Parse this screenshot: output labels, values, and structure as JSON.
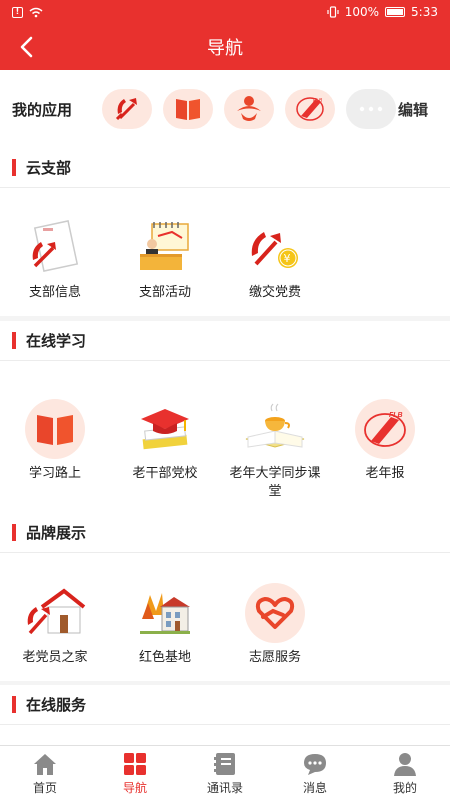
{
  "status_bar": {
    "battery": "100%",
    "time": "5:33"
  },
  "header": {
    "title": "导航"
  },
  "my_apps": {
    "label": "我的应用",
    "edit_label": "编辑",
    "icons": [
      "party-emblem-icon",
      "book-icon",
      "person-emblem-icon",
      "newspaper-logo-icon",
      "more-dots-icon"
    ]
  },
  "sections": [
    {
      "title": "云支部",
      "items": [
        {
          "label": "支部信息",
          "icon": "party-document-icon"
        },
        {
          "label": "支部活动",
          "icon": "meeting-podium-icon"
        },
        {
          "label": "缴交党费",
          "icon": "party-fee-icon"
        }
      ]
    },
    {
      "title": "在线学习",
      "items": [
        {
          "label": "学习路上",
          "icon": "book-icon"
        },
        {
          "label": "老干部党校",
          "icon": "graduation-cap-icon"
        },
        {
          "label": "老年大学同步课堂",
          "icon": "tea-book-icon"
        },
        {
          "label": "老年报",
          "icon": "newspaper-logo-icon"
        }
      ]
    },
    {
      "title": "品牌展示",
      "items": [
        {
          "label": "老党员之家",
          "icon": "party-house-icon"
        },
        {
          "label": "红色基地",
          "icon": "autumn-building-icon"
        },
        {
          "label": "志愿服务",
          "icon": "heart-hand-icon"
        }
      ]
    },
    {
      "title": "在线服务",
      "items": []
    }
  ],
  "tabbar": {
    "items": [
      {
        "label": "首页",
        "icon": "home-icon",
        "active": false
      },
      {
        "label": "导航",
        "icon": "grid-icon",
        "active": true
      },
      {
        "label": "通讯录",
        "icon": "contacts-book-icon",
        "active": false
      },
      {
        "label": "消息",
        "icon": "chat-bubble-icon",
        "active": false
      },
      {
        "label": "我的",
        "icon": "user-icon",
        "active": false
      }
    ]
  },
  "colors": {
    "brand": "#e8312e",
    "chip_bg": "#fde7df"
  }
}
